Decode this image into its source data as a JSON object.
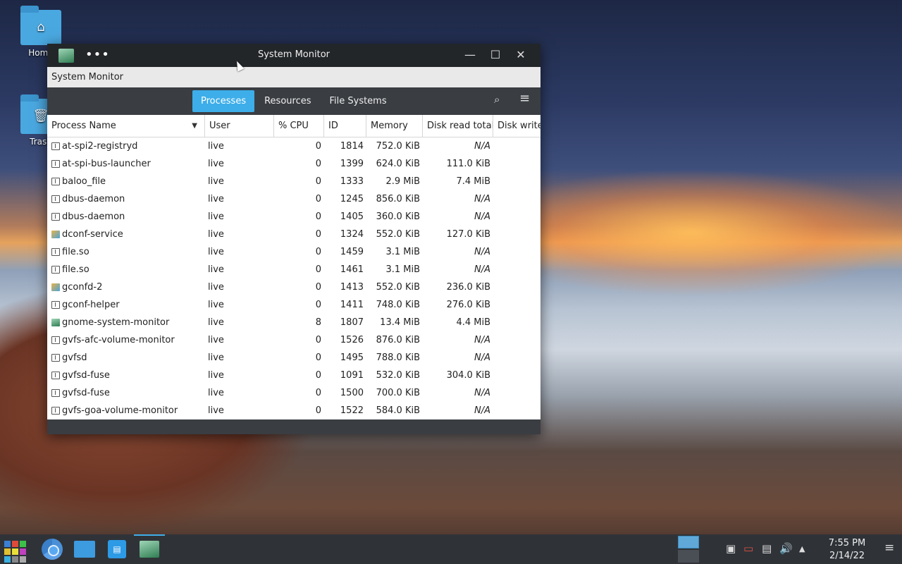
{
  "desktop": {
    "icons": [
      {
        "label": "Home",
        "glyph": "⌂"
      },
      {
        "label": "Trash",
        "glyph": "🗑"
      }
    ]
  },
  "window": {
    "title": "System Monitor",
    "menu_title": "System Monitor",
    "more_glyph": "•••",
    "minimize_glyph": "—",
    "maximize_glyph": "☐",
    "close_glyph": "✕"
  },
  "toolbar": {
    "tabs": [
      {
        "label": "Processes",
        "active": true
      },
      {
        "label": "Resources",
        "active": false
      },
      {
        "label": "File Systems",
        "active": false
      }
    ],
    "search_glyph": "⌕",
    "menu_glyph": "≡"
  },
  "table": {
    "columns": [
      "Process Name",
      "User",
      "% CPU",
      "ID",
      "Memory",
      "Disk read total",
      "Disk write"
    ],
    "sort_glyph": "▼",
    "rows": [
      {
        "icon": "terminal",
        "name": "at-spi2-registryd",
        "user": "live",
        "cpu": "0",
        "id": "1814",
        "mem": "752.0 KiB",
        "dr": "N/A"
      },
      {
        "icon": "terminal",
        "name": "at-spi-bus-launcher",
        "user": "live",
        "cpu": "0",
        "id": "1399",
        "mem": "624.0 KiB",
        "dr": "111.0 KiB"
      },
      {
        "icon": "terminal",
        "name": "baloo_file",
        "user": "live",
        "cpu": "0",
        "id": "1333",
        "mem": "2.9 MiB",
        "dr": "7.4 MiB"
      },
      {
        "icon": "terminal",
        "name": "dbus-daemon",
        "user": "live",
        "cpu": "0",
        "id": "1245",
        "mem": "856.0 KiB",
        "dr": "N/A"
      },
      {
        "icon": "terminal",
        "name": "dbus-daemon",
        "user": "live",
        "cpu": "0",
        "id": "1405",
        "mem": "360.0 KiB",
        "dr": "N/A"
      },
      {
        "icon": "color",
        "name": "dconf-service",
        "user": "live",
        "cpu": "0",
        "id": "1324",
        "mem": "552.0 KiB",
        "dr": "127.0 KiB"
      },
      {
        "icon": "terminal",
        "name": "file.so",
        "user": "live",
        "cpu": "0",
        "id": "1459",
        "mem": "3.1 MiB",
        "dr": "N/A"
      },
      {
        "icon": "terminal",
        "name": "file.so",
        "user": "live",
        "cpu": "0",
        "id": "1461",
        "mem": "3.1 MiB",
        "dr": "N/A"
      },
      {
        "icon": "color",
        "name": "gconfd-2",
        "user": "live",
        "cpu": "0",
        "id": "1413",
        "mem": "552.0 KiB",
        "dr": "236.0 KiB"
      },
      {
        "icon": "terminal",
        "name": "gconf-helper",
        "user": "live",
        "cpu": "0",
        "id": "1411",
        "mem": "748.0 KiB",
        "dr": "276.0 KiB"
      },
      {
        "icon": "gsm",
        "name": "gnome-system-monitor",
        "user": "live",
        "cpu": "8",
        "id": "1807",
        "mem": "13.4 MiB",
        "dr": "4.4 MiB"
      },
      {
        "icon": "terminal",
        "name": "gvfs-afc-volume-monitor",
        "user": "live",
        "cpu": "0",
        "id": "1526",
        "mem": "876.0 KiB",
        "dr": "N/A"
      },
      {
        "icon": "terminal",
        "name": "gvfsd",
        "user": "live",
        "cpu": "0",
        "id": "1495",
        "mem": "788.0 KiB",
        "dr": "N/A"
      },
      {
        "icon": "terminal",
        "name": "gvfsd-fuse",
        "user": "live",
        "cpu": "0",
        "id": "1091",
        "mem": "532.0 KiB",
        "dr": "304.0 KiB"
      },
      {
        "icon": "terminal",
        "name": "gvfsd-fuse",
        "user": "live",
        "cpu": "0",
        "id": "1500",
        "mem": "700.0 KiB",
        "dr": "N/A"
      },
      {
        "icon": "terminal",
        "name": "gvfs-goa-volume-monitor",
        "user": "live",
        "cpu": "0",
        "id": "1522",
        "mem": "584.0 KiB",
        "dr": "N/A"
      }
    ]
  },
  "taskbar": {
    "store_glyph": "▤",
    "tray": {
      "usb_glyph": "▣",
      "display_glyph": "▭",
      "clipboard_glyph": "▤",
      "volume_glyph": "🔊",
      "expand_glyph": "▲",
      "menu_glyph": "≡"
    },
    "clock_time": "7:55 PM",
    "clock_date": "2/14/22"
  },
  "colors": {
    "accent": "#3daee9",
    "titlebar": "#232629",
    "panel": "#2f3338"
  }
}
